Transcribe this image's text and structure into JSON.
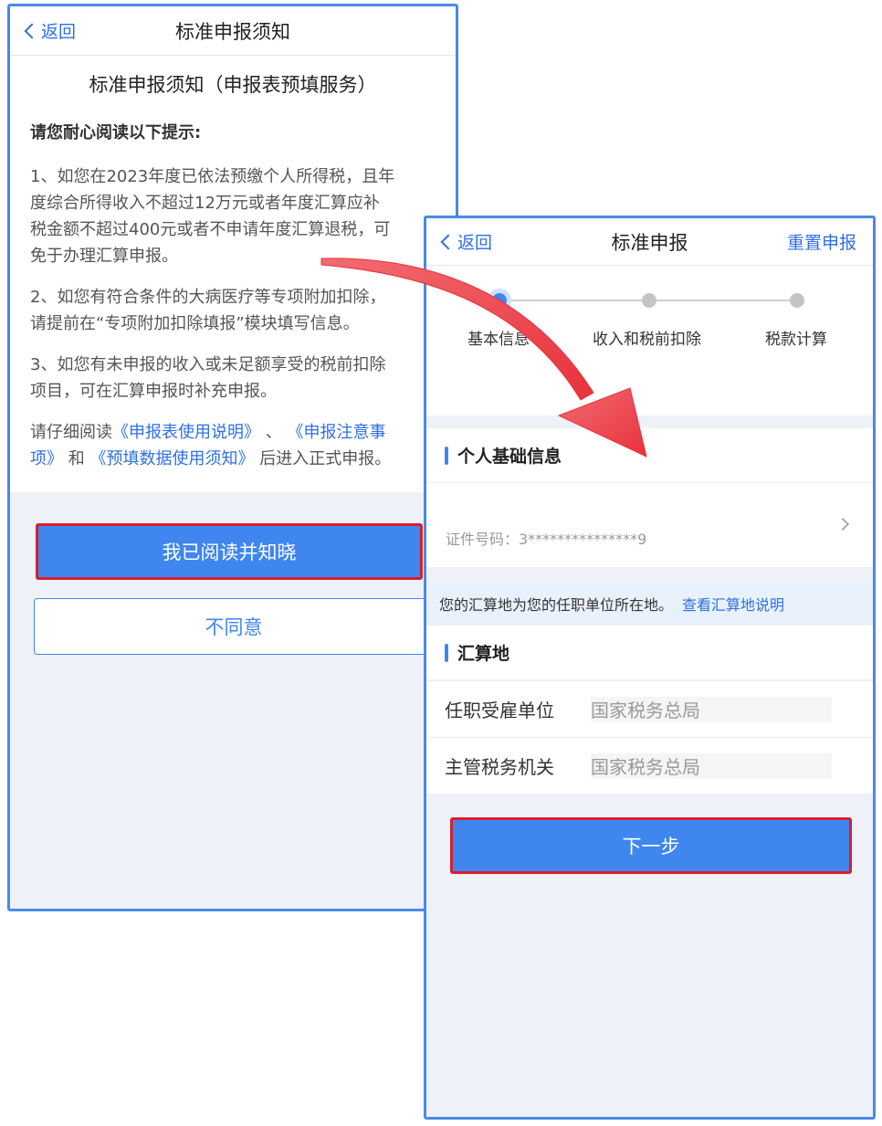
{
  "left": {
    "nav": {
      "back": "返回",
      "title": "标准申报须知"
    },
    "notice_title": "标准申报须知（申报表预填服务）",
    "lead": "请您耐心阅读以下提示:",
    "para1": [
      "1、如您在2023年度已依法预缴个人所得税，且年",
      "度综合所得收入不超过12万元或者年度汇算应补",
      "税金额不超过400元或者不申请年度汇算退税，可",
      "免于办理汇算申报。"
    ],
    "para2": [
      "2、如您有符合条件的大病医疗等专项附加扣除，",
      "请提前在“专项附加扣除填报”模块填写信息。"
    ],
    "para3": [
      "3、如您有未申报的收入或未足额享受的税前扣除",
      "项目，可在汇算申报时补充申报。"
    ],
    "para4": {
      "prefix": "请仔细阅读",
      "link1": "《申报表使用说明》",
      "sep": "、",
      "link2_a": "《申报注意事",
      "link2_b": "项》",
      "and": "和",
      "link3": "《预填数据使用须知》",
      "suffix": "后进入正式申报。"
    },
    "btn_agree": "我已阅读并知晓",
    "btn_disagree": "不同意"
  },
  "right": {
    "nav": {
      "back": "返回",
      "title": "标准申报",
      "action": "重置申报"
    },
    "steps": [
      "基本信息",
      "收入和税前扣除",
      "税款计算"
    ],
    "section_personal": "个人基础信息",
    "id_label": "证件号码：3***************9",
    "tip_text": "您的汇算地为您的任职单位所在地。",
    "tip_link": "查看汇算地说明",
    "section_place": "汇算地",
    "rows": [
      {
        "key": "任职受雇单位",
        "value": "国家税务总局"
      },
      {
        "key": "主管税务机关",
        "value": "国家税务总局"
      }
    ],
    "btn_next": "下一步"
  },
  "colors": {
    "accent": "#3f86ef",
    "highlight": "#d81e2b",
    "arrow": "#f0454d"
  }
}
